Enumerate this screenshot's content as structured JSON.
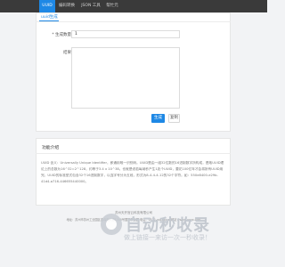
{
  "nav": {
    "items": [
      {
        "label": "UUID",
        "active": true
      },
      {
        "label": "编码转换",
        "active": false
      },
      {
        "label": "JSON 工具",
        "active": false
      },
      {
        "label": "帮忙元",
        "active": false
      }
    ]
  },
  "generator": {
    "tab_label": "uuid生成",
    "count_label": "* 生成数量",
    "count_value": "1",
    "result_label": "结果",
    "result_value": "",
    "generate_button": "生成",
    "copy_button": "复制"
  },
  "about": {
    "title": "功能介绍",
    "description": "UUID 含义：Universally Unique Identifier，即通用唯一识别码。UUID是由一组32位数的16进制数字所构成，是故UUID理论上的总数为16^32=2^128，约等于3.4 x 10^38。也就是说若每纳秒产生1兆个UUID，要花100亿年才会将所有UUID用完。UUID的标准型式包含32个16进制数字，以连字号分为五段，形式为8-4-4-4-12的32个字符。如：550e8400-e29b-41d4-a716-446655440000。"
  },
  "footer": {
    "line1": "苏州天开宫云科技有限公司",
    "line2": "地址：苏州市苏州工业园区金鸡湖大道1355号国际科技园 电话：0512-xxxxxxxx 网站：www.xxxx.com"
  },
  "watermark": {
    "title": "自动秒收录",
    "subtitle": "做上链接一来访一次一秒收录！",
    "icon": "logo-icon"
  },
  "colors": {
    "accent": "#1e88e5",
    "nav_bg": "#3a3a3a",
    "page_bg": "#f2f3f5"
  }
}
